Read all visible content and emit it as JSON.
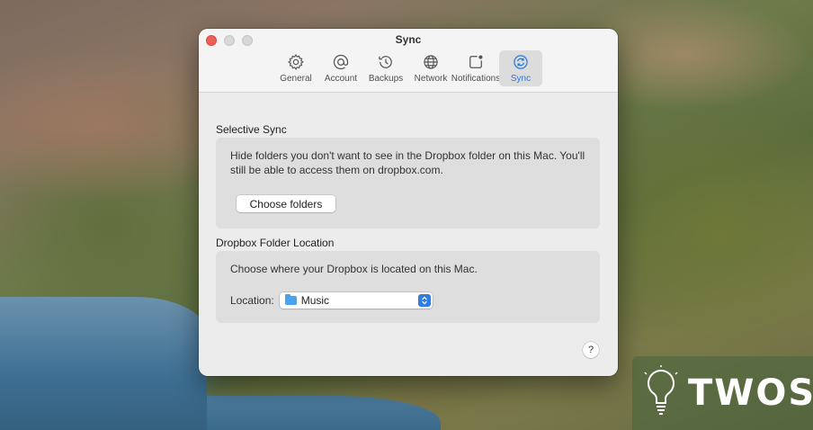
{
  "window": {
    "title": "Sync",
    "tabs": [
      {
        "label": "General",
        "icon": "gear-icon"
      },
      {
        "label": "Account",
        "icon": "at-sign-icon"
      },
      {
        "label": "Backups",
        "icon": "clock-history-icon"
      },
      {
        "label": "Network",
        "icon": "globe-icon"
      },
      {
        "label": "Notifications",
        "icon": "notification-badge-icon"
      },
      {
        "label": "Sync",
        "icon": "sync-icon",
        "active": true
      }
    ]
  },
  "selective_sync": {
    "title": "Selective Sync",
    "description": "Hide folders you don't want to see in the Dropbox folder on this Mac. You'll still be able to access them on dropbox.com.",
    "button_label": "Choose folders"
  },
  "folder_location": {
    "title": "Dropbox Folder Location",
    "description": "Choose where your Dropbox is located on this Mac.",
    "location_label": "Location:",
    "location_value": "Music"
  },
  "help": {
    "label": "?"
  },
  "watermark": {
    "text": "TWOS"
  },
  "colors": {
    "accent": "#2a78e0",
    "close": "#ee5f57",
    "folder": "#4aa3ef"
  }
}
